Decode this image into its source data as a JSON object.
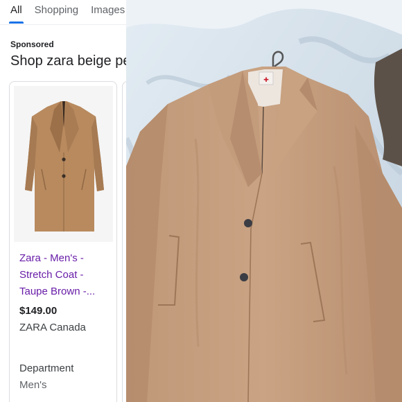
{
  "search": {
    "tabs": [
      "All",
      "Shopping",
      "Images"
    ],
    "active_tab": "All",
    "sponsored_label": "Sponsored",
    "shop_heading": "Shop zara beige pe"
  },
  "product": {
    "title_lines": [
      "Zara - Men's -",
      "Stretch Coat -",
      "Taupe Brown -..."
    ],
    "price": "$149.00",
    "seller": "ZARA Canada",
    "department_label": "Department",
    "department_value": "Men's",
    "image_icon": "camel-overcoat-image"
  },
  "photo": {
    "subject": "camel-overcoat-photo",
    "colors": {
      "coat": "#c49c7c",
      "coat_shadow": "#a87f62",
      "sheet": "#d8e4ee",
      "sheet_shadow": "#aebfcf",
      "button": "#3b3d44"
    }
  },
  "colors": {
    "link_purple": "#681da8",
    "accent_blue": "#1a73e8",
    "text_dark": "#202124",
    "text_gray": "#5f6368"
  }
}
